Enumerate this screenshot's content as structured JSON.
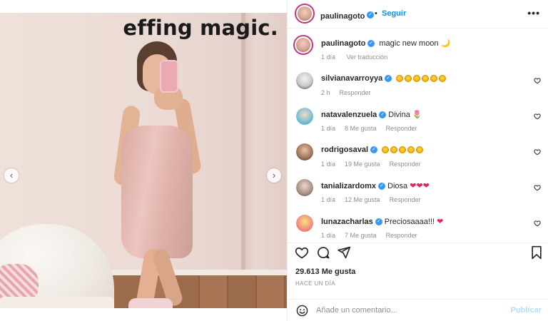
{
  "post": {
    "image_caption": "effing magic.",
    "carousel": {
      "current_index": 1,
      "total": 5
    }
  },
  "header": {
    "username": "paulinagoto",
    "separator": "•",
    "follow_label": "Seguir",
    "more_label": "•••"
  },
  "caption_row": {
    "username": "paulinagoto",
    "text": "magic new moon 🌙",
    "time": "1 día",
    "translate_label": "Ver traducción"
  },
  "comments": [
    {
      "username": "silvianavarroyya",
      "text": "",
      "emoji_count": 6,
      "emoji": "star-struck",
      "time": "2 h",
      "likes": "",
      "reply_label": "Responder"
    },
    {
      "username": "natavalenzuela",
      "text": "Divina",
      "emoji_count": 1,
      "emoji": "tulip",
      "time": "1 día",
      "likes": "8 Me gusta",
      "reply_label": "Responder"
    },
    {
      "username": "rodrigosaval",
      "text": "",
      "emoji_count": 5,
      "emoji": "star-struck",
      "time": "1 día",
      "likes": "19 Me gusta",
      "reply_label": "Responder"
    },
    {
      "username": "tanializardomx",
      "text": "Diosa",
      "emoji_count": 3,
      "emoji": "red-heart",
      "time": "1 día",
      "likes": "12 Me gusta",
      "reply_label": "Responder"
    },
    {
      "username": "lunazacharlas",
      "text": "Preciosaaaa!!!",
      "emoji_count": 1,
      "emoji": "red-heart",
      "time": "1 día",
      "likes": "7 Me gusta",
      "reply_label": "Responder"
    }
  ],
  "stats": {
    "likes": "29.613 Me gusta",
    "posted": "HACE UN DÍA"
  },
  "add_comment": {
    "placeholder": "Añade un comentario...",
    "publish_label": "Publicar"
  },
  "colors": {
    "accent": "#0095f6",
    "verified": "#3897f0",
    "muted": "#8e8e8e",
    "text": "#262626"
  }
}
